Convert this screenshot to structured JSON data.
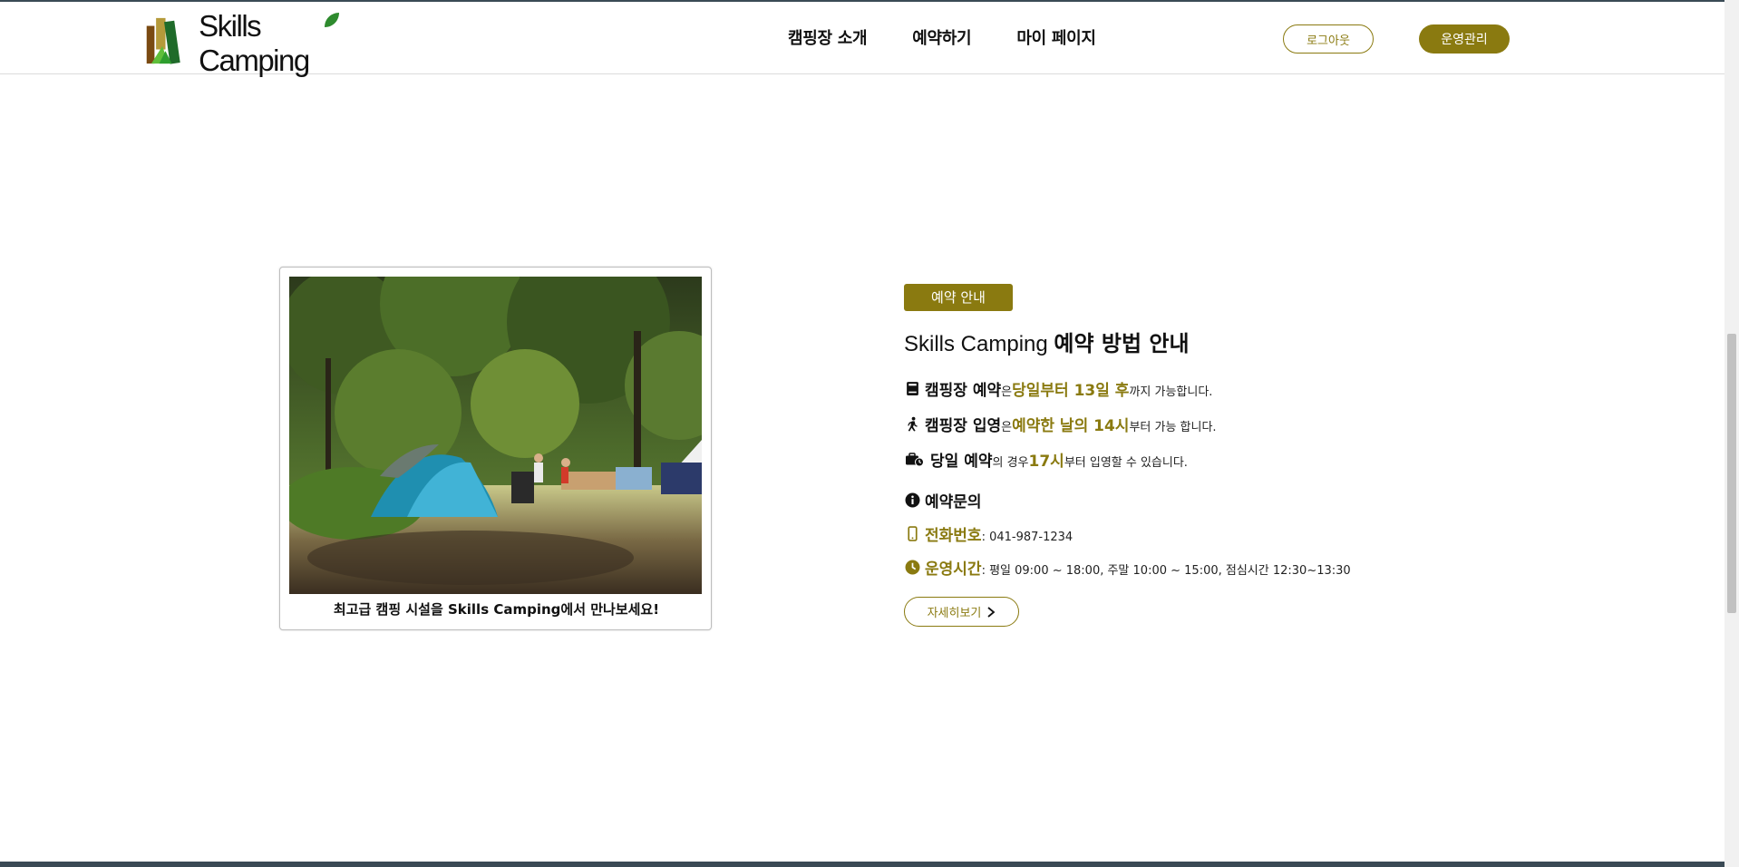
{
  "header": {
    "logo_text": "Skills Camping",
    "nav": [
      {
        "label": "캠핑장 소개"
      },
      {
        "label": "예약하기"
      },
      {
        "label": "마이 페이지"
      }
    ],
    "logout_label": "로그아웃",
    "admin_label": "운영관리"
  },
  "photo_card": {
    "caption": "최고급 캠핑 시설을 Skills Camping에서 만나보세요!"
  },
  "info": {
    "badge": "예약 안내",
    "title_normal": "Skills Camping ",
    "title_bold": "예약 방법 안내",
    "lines": [
      {
        "icon": "book-icon",
        "strong": "캠핑장 예약",
        "mid": "은 ",
        "gold": "당일부터 13일 후",
        "rest": "까지 가능합니다."
      },
      {
        "icon": "walking-icon",
        "strong": "캠핑장 입영",
        "mid": "은 ",
        "gold": "예약한 날의 14시",
        "rest": "부터 가능 합니다."
      },
      {
        "icon": "business-time-icon",
        "strong": "당일 예약",
        "mid": "의 경우 ",
        "gold": "17시",
        "rest": "부터 입영할 수 있습니다."
      }
    ],
    "contact_title": "예약문의",
    "phone_label": "전화번호",
    "phone_value": " : 041-987-1234",
    "hours_label": "운영시간",
    "hours_value": " : 평일 09:00 ~ 18:00, 주말 10:00 ~ 15:00, 점심시간 12:30~13:30",
    "more_label": "자세히보기"
  },
  "colors": {
    "accent": "#8a7a10",
    "text": "#111111",
    "border": "#bdbdbd"
  }
}
